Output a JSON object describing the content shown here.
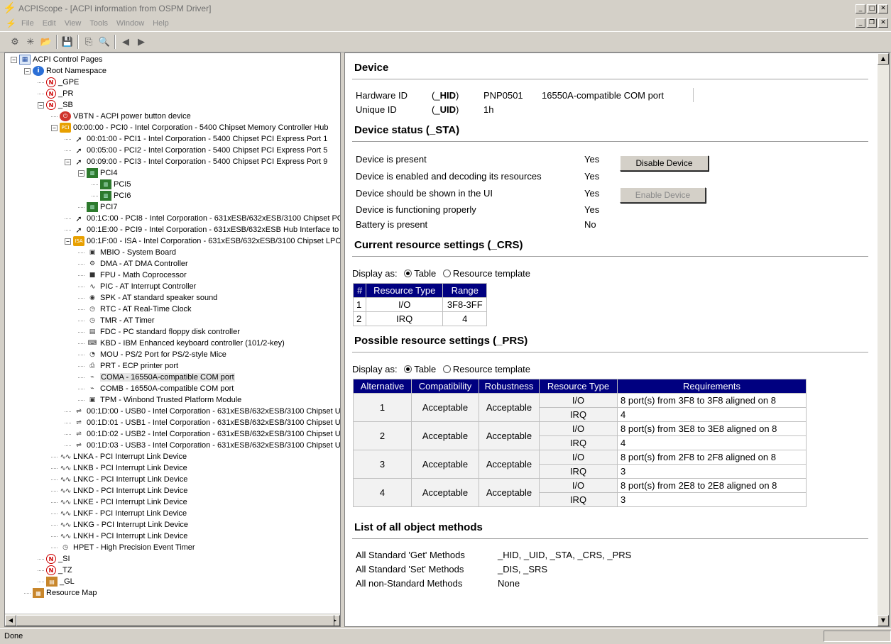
{
  "window": {
    "title": "ACPIScope - [ACPI information from OSPM Driver]"
  },
  "menu": [
    "File",
    "Edit",
    "View",
    "Tools",
    "Window",
    "Help"
  ],
  "toolbar": [
    {
      "name": "connect-icon",
      "glyph": "⚙"
    },
    {
      "name": "refresh-icon",
      "glyph": "✳"
    },
    {
      "name": "open-folder-icon",
      "glyph": "📂"
    },
    {
      "name": "save-icon",
      "glyph": "💾"
    },
    {
      "name": "copy-icon",
      "glyph": "⎘"
    },
    {
      "name": "find-icon",
      "glyph": "🔍"
    },
    {
      "name": "back-icon",
      "glyph": "◀"
    },
    {
      "name": "forward-icon",
      "glyph": "▶"
    }
  ],
  "tree": [
    {
      "label": "ACPI Control Pages",
      "icon": "pg",
      "glyph": "▦",
      "exp": "-"
    },
    {
      "label": "Root Namespace",
      "icon": "info",
      "glyph": "i",
      "exp": "-"
    },
    {
      "label": "_GPE",
      "icon": "ns",
      "glyph": "N"
    },
    {
      "label": "_PR",
      "icon": "ns",
      "glyph": "N"
    },
    {
      "label": "_SB",
      "icon": "ns",
      "glyph": "N",
      "exp": "-"
    },
    {
      "label": "VBTN - ACPI power button device",
      "icon": "red",
      "glyph": "⏻"
    },
    {
      "label": "00:00:00 - PCI0 - Intel Corporation - 5400 Chipset Memory Controller Hub",
      "icon": "pci",
      "glyph": "PCI",
      "exp": "-"
    },
    {
      "label": "00:01:00 - PCI1 - Intel Corporation - 5400 Chipset PCI Express Port 1",
      "icon": "bridge",
      "glyph": "➚"
    },
    {
      "label": "00:05:00 - PCI2 - Intel Corporation - 5400 Chipset PCI Express Port 5",
      "icon": "bridge",
      "glyph": "➚"
    },
    {
      "label": "00:09:00 - PCI3 - Intel Corporation - 5400 Chipset PCI Express Port 9",
      "icon": "bridge",
      "glyph": "➚",
      "exp": "-"
    },
    {
      "label": "PCI4",
      "icon": "chip",
      "glyph": "▥",
      "exp": "-"
    },
    {
      "label": "PCI5",
      "icon": "chip",
      "glyph": "▥"
    },
    {
      "label": "PCI6",
      "icon": "chip",
      "glyph": "▥"
    },
    {
      "label": "PCI7",
      "icon": "chip",
      "glyph": "▥"
    },
    {
      "label": "00:1C:00 - PCI8 - Intel Corporation - 631xESB/632xESB/3100 Chipset PCI",
      "icon": "bridge",
      "glyph": "➚"
    },
    {
      "label": "00:1E:00 - PCI9 - Intel Corporation - 631xESB/632xESB Hub Interface to",
      "icon": "bridge",
      "glyph": "➚"
    },
    {
      "label": "00:1F:00 - ISA - Intel Corporation - 631xESB/632xESB/3100 Chipset LPC",
      "icon": "pci",
      "glyph": "ISA",
      "exp": "-"
    },
    {
      "label": "MBIO - System Board",
      "icon": "dev",
      "glyph": "▣"
    },
    {
      "label": "DMA - AT DMA Controller",
      "icon": "dev",
      "glyph": "⚙"
    },
    {
      "label": "FPU - Math Coprocessor",
      "icon": "dev",
      "glyph": "■"
    },
    {
      "label": "PIC - AT Interrupt Controller",
      "icon": "irq",
      "glyph": "∿"
    },
    {
      "label": "SPK - AT standard speaker sound",
      "icon": "dev",
      "glyph": "◉"
    },
    {
      "label": "RTC - AT Real-Time Clock",
      "icon": "dev",
      "glyph": "◷"
    },
    {
      "label": "TMR - AT Timer",
      "icon": "dev",
      "glyph": "◷"
    },
    {
      "label": "FDC - PC standard floppy disk controller",
      "icon": "dev",
      "glyph": "▤"
    },
    {
      "label": "KBD - IBM Enhanced keyboard controller (101/2-key)",
      "icon": "dev",
      "glyph": "⌨"
    },
    {
      "label": "MOU - PS/2 Port for PS/2-style Mice",
      "icon": "dev",
      "glyph": "◔"
    },
    {
      "label": "PRT - ECP printer port",
      "icon": "dev",
      "glyph": "⎙"
    },
    {
      "label": "COMA - 16550A-compatible COM port",
      "icon": "dev",
      "glyph": "⌁",
      "selected": true
    },
    {
      "label": "COMB - 16550A-compatible COM port",
      "icon": "dev",
      "glyph": "⌁"
    },
    {
      "label": "TPM - Winbond Trusted Platform Module",
      "icon": "dev",
      "glyph": "▣"
    },
    {
      "label": "00:1D:00 - USB0 - Intel Corporation - 631xESB/632xESB/3100 Chipset UH",
      "icon": "dev",
      "glyph": "⇌"
    },
    {
      "label": "00:1D:01 - USB1 - Intel Corporation - 631xESB/632xESB/3100 Chipset UH",
      "icon": "dev",
      "glyph": "⇌"
    },
    {
      "label": "00:1D:02 - USB2 - Intel Corporation - 631xESB/632xESB/3100 Chipset UH",
      "icon": "dev",
      "glyph": "⇌"
    },
    {
      "label": "00:1D:03 - USB3 - Intel Corporation - 631xESB/632xESB/3100 Chipset UH",
      "icon": "dev",
      "glyph": "⇌"
    },
    {
      "label": "LNKA - PCI Interrupt Link Device",
      "icon": "irq",
      "glyph": "∿∿"
    },
    {
      "label": "LNKB - PCI Interrupt Link Device",
      "icon": "irq",
      "glyph": "∿∿"
    },
    {
      "label": "LNKC - PCI Interrupt Link Device",
      "icon": "irq",
      "glyph": "∿∿"
    },
    {
      "label": "LNKD - PCI Interrupt Link Device",
      "icon": "irq",
      "glyph": "∿∿"
    },
    {
      "label": "LNKE - PCI Interrupt Link Device",
      "icon": "irq",
      "glyph": "∿∿"
    },
    {
      "label": "LNKF - PCI Interrupt Link Device",
      "icon": "irq",
      "glyph": "∿∿"
    },
    {
      "label": "LNKG - PCI Interrupt Link Device",
      "icon": "irq",
      "glyph": "∿∿"
    },
    {
      "label": "LNKH - PCI Interrupt Link Device",
      "icon": "irq",
      "glyph": "∿∿"
    },
    {
      "label": "HPET - High Precision Event Timer",
      "icon": "dev",
      "glyph": "◷"
    },
    {
      "label": "_SI",
      "icon": "ns",
      "glyph": "N"
    },
    {
      "label": "_TZ",
      "icon": "ns",
      "glyph": "N"
    },
    {
      "label": "_GL",
      "icon": "gl",
      "glyph": "▤"
    },
    {
      "label": "Resource Map",
      "icon": "map",
      "glyph": "▦"
    }
  ],
  "device": {
    "heading": "Device",
    "hid_label": "Hardware ID",
    "hid_code": "(_HID)",
    "hid_value": "PNP0501",
    "hid_desc": "16550A-compatible COM port",
    "uid_label": "Unique ID",
    "uid_code": "(_UID)",
    "uid_value": "1h"
  },
  "status": {
    "heading": "Device status (_STA)",
    "rows": [
      {
        "label": "Device is present",
        "value": "Yes"
      },
      {
        "label": "Device is enabled and decoding its resources",
        "value": "Yes"
      },
      {
        "label": "Device should be shown in the UI",
        "value": "Yes"
      },
      {
        "label": "Device is functioning properly",
        "value": "Yes"
      },
      {
        "label": "Battery is present",
        "value": "No"
      }
    ],
    "disable_button": "Disable Device",
    "enable_button": "Enable Device"
  },
  "crs": {
    "heading": "Current resource settings (_CRS)",
    "display_as": "Display as:",
    "opt_table": "Table",
    "opt_template": "Resource template",
    "headers": [
      "#",
      "Resource Type",
      "Range"
    ],
    "rows": [
      [
        "1",
        "I/O",
        "3F8-3FF"
      ],
      [
        "2",
        "IRQ",
        "4"
      ]
    ]
  },
  "prs": {
    "heading": "Possible resource settings (_PRS)",
    "display_as": "Display as:",
    "opt_table": "Table",
    "opt_template": "Resource template",
    "headers": [
      "Alternative",
      "Compatibility",
      "Robustness",
      "Resource Type",
      "Requirements"
    ],
    "groups": [
      {
        "alt": "1",
        "compat": "Acceptable",
        "robust": "Acceptable",
        "io": "I/O",
        "io_req": "8 port(s) from 3F8 to 3F8 aligned on 8",
        "irq": "IRQ",
        "irq_req": "4"
      },
      {
        "alt": "2",
        "compat": "Acceptable",
        "robust": "Acceptable",
        "io": "I/O",
        "io_req": "8 port(s) from 3E8 to 3E8 aligned on 8",
        "irq": "IRQ",
        "irq_req": "4"
      },
      {
        "alt": "3",
        "compat": "Acceptable",
        "robust": "Acceptable",
        "io": "I/O",
        "io_req": "8 port(s) from 2F8 to 2F8 aligned on 8",
        "irq": "IRQ",
        "irq_req": "3"
      },
      {
        "alt": "4",
        "compat": "Acceptable",
        "robust": "Acceptable",
        "io": "I/O",
        "io_req": "8 port(s) from 2E8 to 2E8 aligned on 8",
        "irq": "IRQ",
        "irq_req": "3"
      }
    ]
  },
  "methods": {
    "heading": "List of all object methods",
    "rows": [
      {
        "label": "All Standard 'Get' Methods",
        "value": "_HID, _UID, _STA, _CRS, _PRS"
      },
      {
        "label": "All Standard 'Set' Methods",
        "value": "_DIS, _SRS"
      },
      {
        "label": "All non-Standard Methods",
        "value": "None"
      }
    ]
  },
  "statusbar": {
    "text": "Done"
  },
  "colors": {
    "table_header": "#000080",
    "window_bg": "#d4d0c8"
  }
}
